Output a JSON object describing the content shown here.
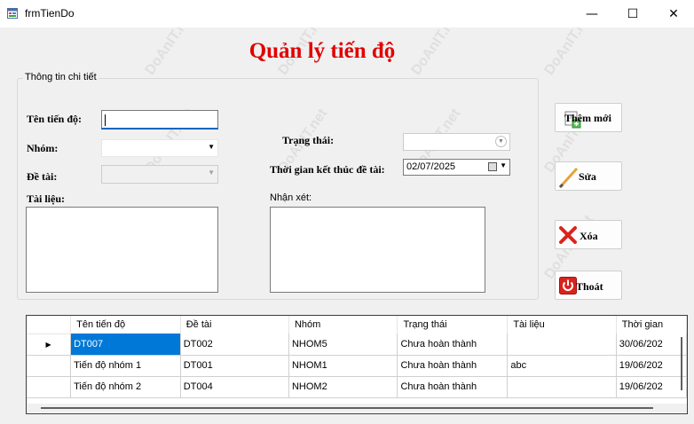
{
  "window": {
    "title": "frmTienDo",
    "minimize": "—",
    "maximize": "☐",
    "close": "✕"
  },
  "header": {
    "title": "Quản lý tiến độ"
  },
  "group": {
    "label": "Thông tin chi tiết"
  },
  "fields": {
    "ten_tien_do_label": "Tên tiến độ:",
    "nhom_label": "Nhóm:",
    "de_tai_label": "Đề tài:",
    "tai_lieu_label": "Tài liệu:",
    "trang_thai_label": "Trạng thái:",
    "thoi_gian_label": "Thời gian kết thúc đề tài:",
    "nhan_xet_label": "Nhận xét:",
    "thoi_gian_value": "02/07/2025"
  },
  "buttons": {
    "them_moi": "Thêm mới",
    "sua": "Sửa",
    "xoa": "Xóa",
    "thoat": "Thoát"
  },
  "grid": {
    "columns": [
      "Tên tiến độ",
      "Đề tài",
      "Nhóm",
      "Trạng thái",
      "Tài liệu",
      "Thời gian"
    ],
    "rows": [
      [
        "DT007",
        "DT002",
        "NHOM5",
        "Chưa hoàn thành",
        "",
        "30/06/202"
      ],
      [
        "Tiến độ nhóm 1",
        "DT001",
        "NHOM1",
        "Chưa hoàn thành",
        "abc",
        "19/06/202"
      ],
      [
        "Tiến độ nhóm 2",
        "DT004",
        "NHOM2",
        "Chưa hoàn thành",
        "",
        "19/06/202"
      ]
    ],
    "current_row_marker": "▶"
  },
  "watermark": "DoAnIT.net",
  "colors": {
    "title": "#e00000",
    "selection": "#0078d7",
    "focus": "#0067c0"
  }
}
